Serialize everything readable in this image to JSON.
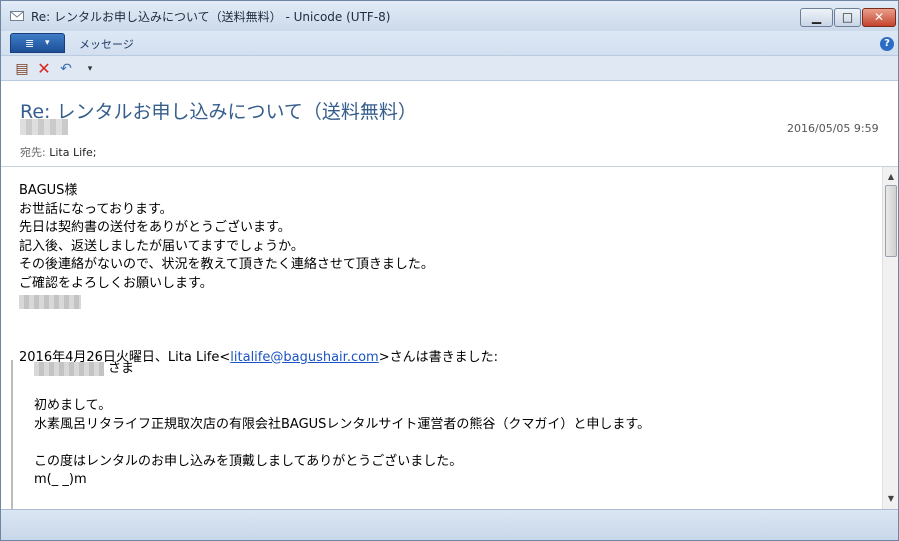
{
  "window": {
    "title": "Re: レンタルお申し込みについて（送料無料） - Unicode (UTF-8)",
    "controls": {
      "minimize": "▁",
      "maximize": "□",
      "close": "✕"
    }
  },
  "ribbon": {
    "file_glyph": "≣",
    "file_caret": "▾",
    "tab_message": "メッセージ",
    "help": "?"
  },
  "qat": {
    "save_icon": "▤",
    "delete_icon": "✕",
    "reply_icon": "↶",
    "more_icon": "▾"
  },
  "header": {
    "subject": "Re: レンタルお申し込みについて（送料無料）",
    "date": "2016/05/05 9:59",
    "to_label": "宛先:",
    "to_value": "Lita Life;"
  },
  "body": {
    "lines": [
      "BAGUS様",
      "お世話になっております。",
      "先日は契約書の送付をありがとうございます。",
      "記入後、返送しましたが届いてますでしょうか。",
      "その後連絡がないので、状況を教えて頂きたく連絡させて頂きました。",
      "ご確認をよろしくお願いします。"
    ],
    "reply_prefix": "2016年4月26日火曜日、Lita Life<",
    "reply_email": "litalife@bagushair.com",
    "reply_suffix": ">さんは書きました:",
    "quote_salutation": "さま",
    "quote_lines": [
      "初めまして。",
      "水素風呂リタライフ正規取次店の有限会社BAGUSレンタルサイト運営者の熊谷（クマガイ）と申します。",
      "この度はレンタルのお申し込みを頂戴しましてありがとうございました。",
      "m(_ _)m"
    ]
  },
  "scrollbar": {
    "up": "▲",
    "down": "▼"
  }
}
